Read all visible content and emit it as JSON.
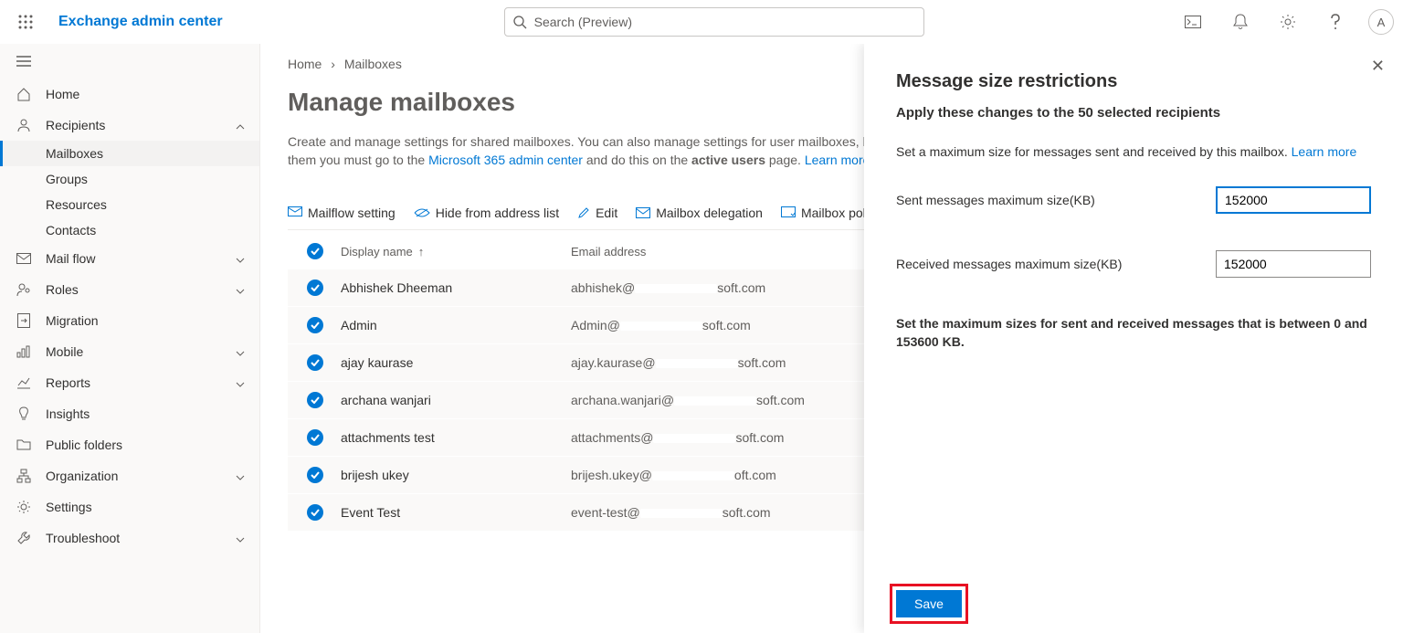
{
  "header": {
    "app_title": "Exchange admin center",
    "search_placeholder": "Search (Preview)",
    "avatar_initial": "A"
  },
  "sidebar": {
    "home": "Home",
    "recipients": "Recipients",
    "sub": {
      "mailboxes": "Mailboxes",
      "groups": "Groups",
      "resources": "Resources",
      "contacts": "Contacts"
    },
    "mailflow": "Mail flow",
    "roles": "Roles",
    "migration": "Migration",
    "mobile": "Mobile",
    "reports": "Reports",
    "insights": "Insights",
    "publicfolders": "Public folders",
    "organization": "Organization",
    "settings": "Settings",
    "troubleshoot": "Troubleshoot"
  },
  "main": {
    "breadcrumb_home": "Home",
    "breadcrumb_current": "Mailboxes",
    "title": "Manage mailboxes",
    "desc1": "Create and manage settings for shared mailboxes. You can also manage settings for user mailboxes, but to add or delete them you must go to the ",
    "desc_link1": "Microsoft 365 admin center",
    "desc2": " and do this on the ",
    "desc_bold": "active users",
    "desc3": " page. ",
    "desc_link2": "Learn more about mailboxes",
    "toolbar": {
      "mailflow": "Mailflow setting",
      "hide": "Hide from address list",
      "edit": "Edit",
      "delegation": "Mailbox delegation",
      "policies": "Mailbox policies"
    },
    "columns": {
      "name": "Display name",
      "email": "Email address"
    },
    "rows": [
      {
        "name": "Abhishek Dheeman",
        "email_a": "abhishek@",
        "email_b": "soft.com"
      },
      {
        "name": "Admin",
        "email_a": "Admin@",
        "email_b": "soft.com"
      },
      {
        "name": "ajay kaurase",
        "email_a": "ajay.kaurase@",
        "email_b": "soft.com"
      },
      {
        "name": "archana wanjari",
        "email_a": "archana.wanjari@",
        "email_b": "soft.com"
      },
      {
        "name": "attachments test",
        "email_a": "attachments@",
        "email_b": "soft.com"
      },
      {
        "name": "brijesh ukey",
        "email_a": "brijesh.ukey@",
        "email_b": "oft.com"
      },
      {
        "name": "Event Test",
        "email_a": "event-test@",
        "email_b": "soft.com"
      }
    ]
  },
  "panel": {
    "title": "Message size restrictions",
    "subtitle": "Apply these changes to the 50 selected recipients",
    "body": "Set a maximum size for messages sent and received by this mailbox. ",
    "body_link": "Learn more",
    "sent_label": "Sent messages maximum size(KB)",
    "sent_value": "152000",
    "recv_label": "Received messages maximum size(KB)",
    "recv_value": "152000",
    "note": "Set the maximum sizes for sent and received messages that is between 0 and 153600 KB.",
    "save": "Save"
  }
}
